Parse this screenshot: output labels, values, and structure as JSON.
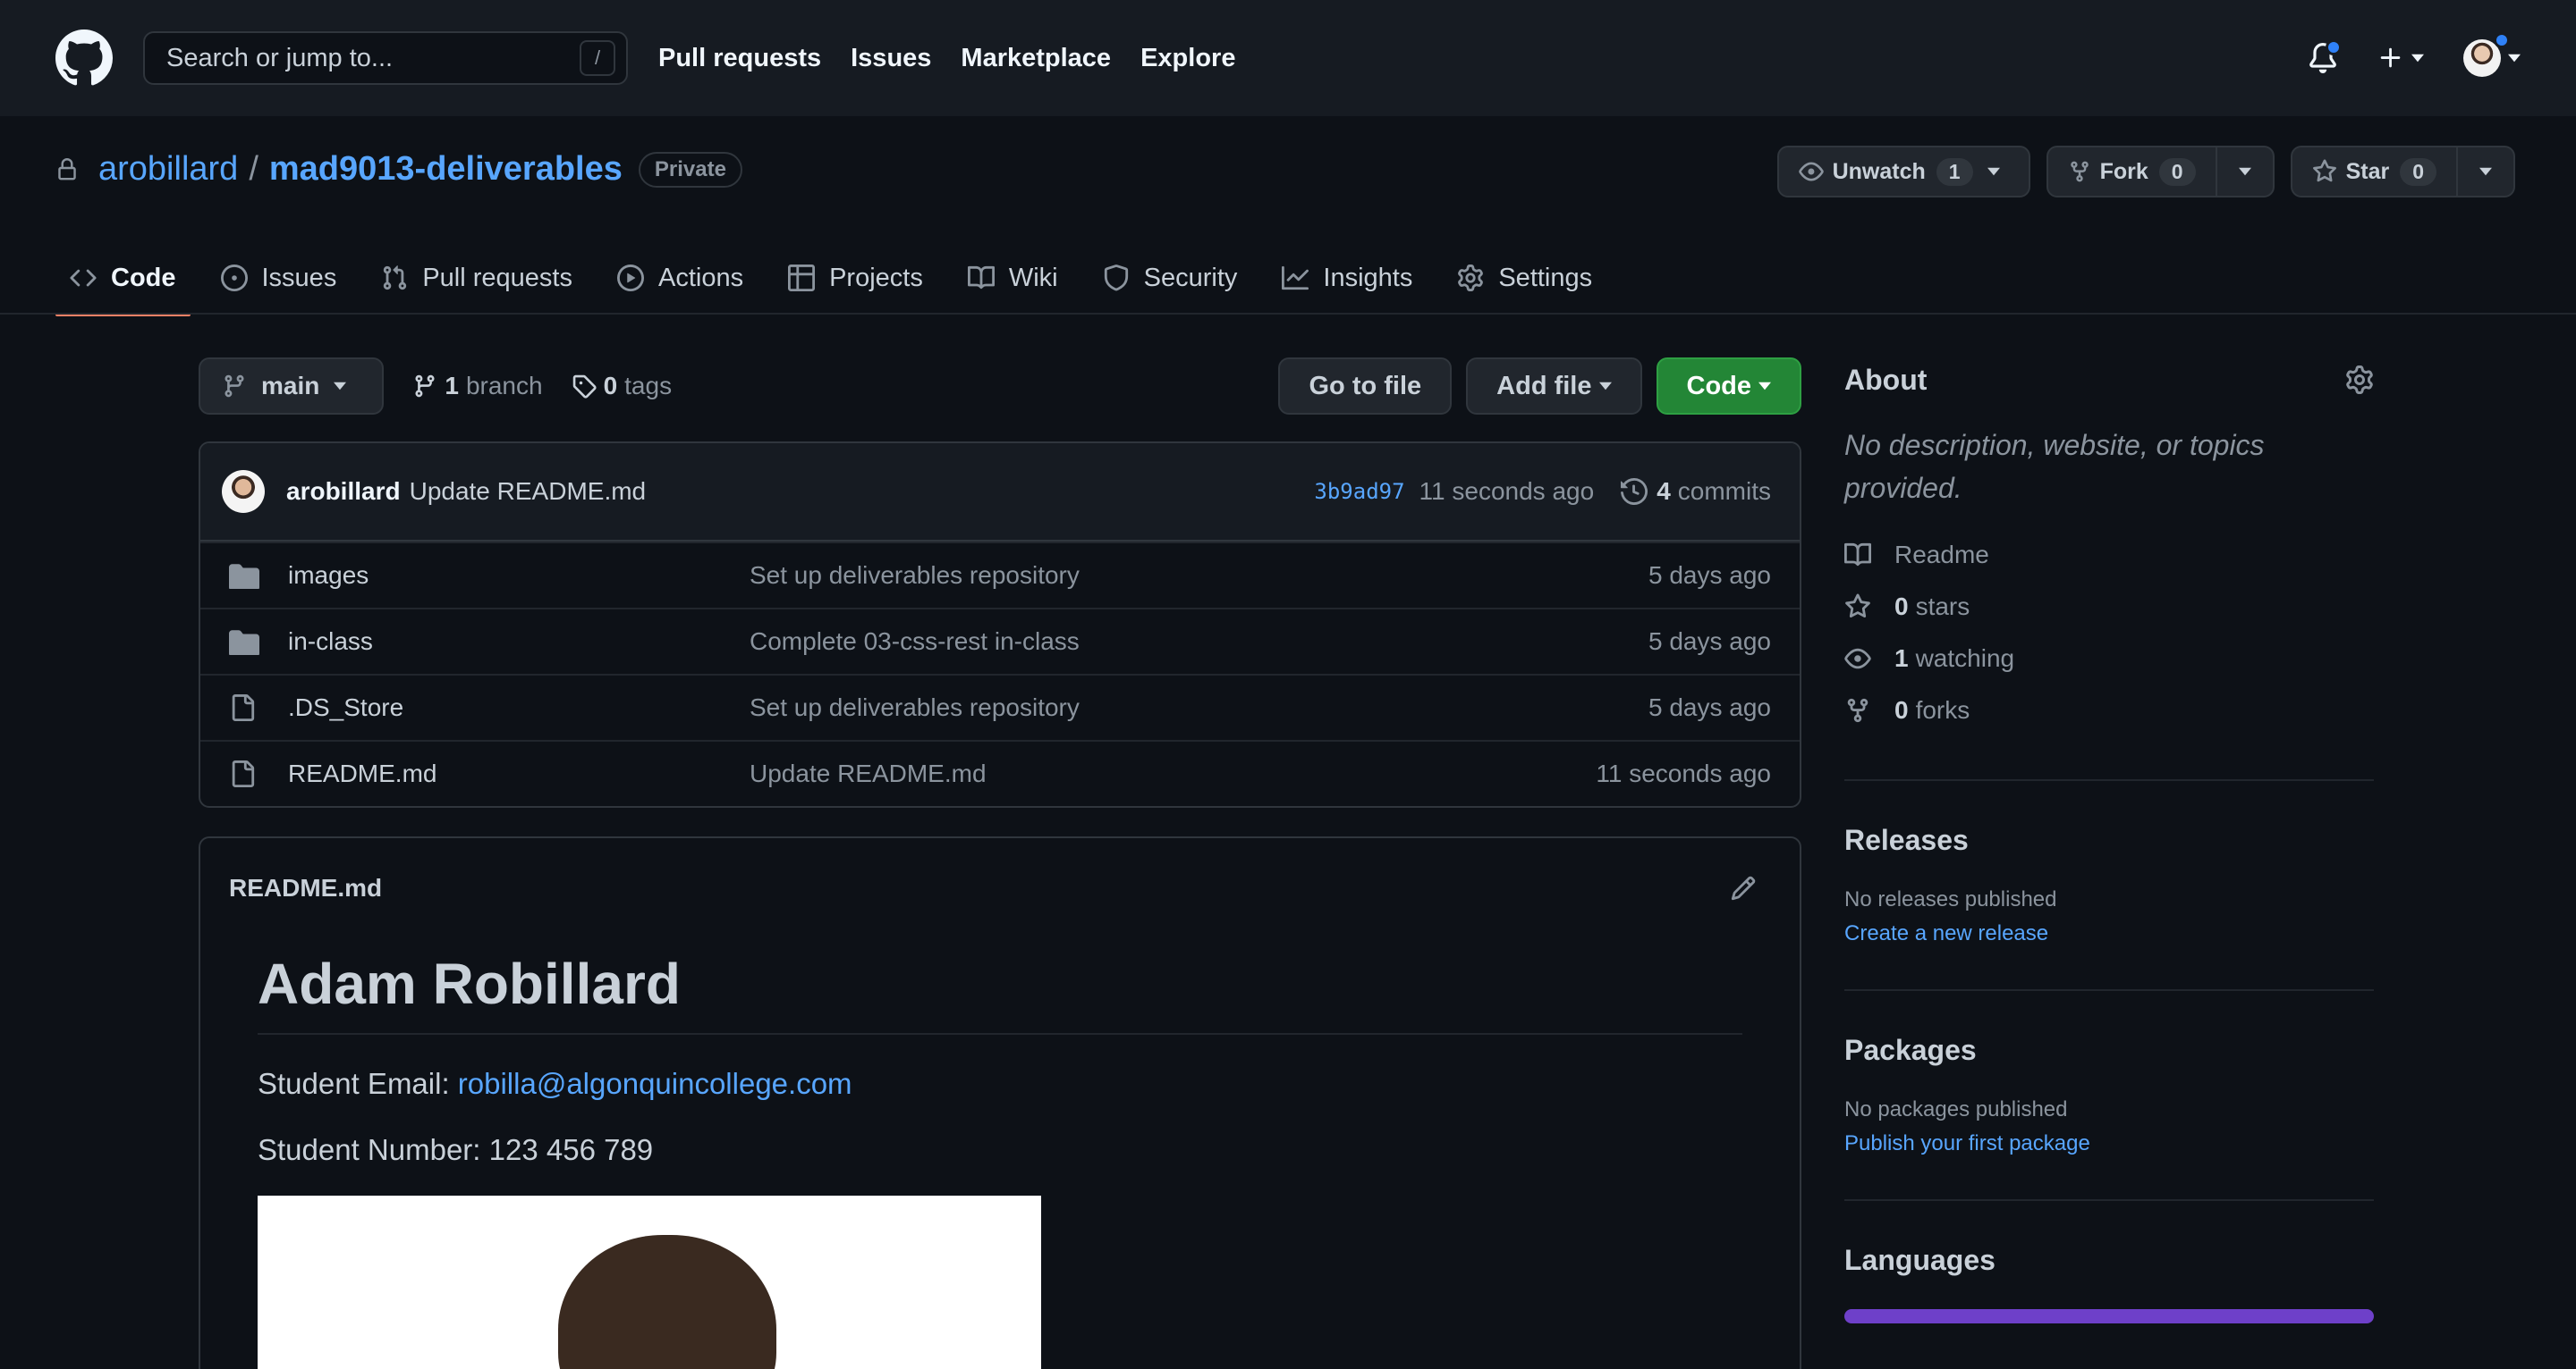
{
  "header": {
    "search_placeholder": "Search or jump to...",
    "search_key": "/",
    "nav": [
      "Pull requests",
      "Issues",
      "Marketplace",
      "Explore"
    ]
  },
  "repo": {
    "owner": "arobillard",
    "separator": "/",
    "name": "mad9013-deliverables",
    "visibility": "Private",
    "watch": {
      "label": "Unwatch",
      "count": "1"
    },
    "fork": {
      "label": "Fork",
      "count": "0"
    },
    "star": {
      "label": "Star",
      "count": "0"
    }
  },
  "tabs": [
    {
      "label": "Code",
      "icon": "code-icon",
      "active": true
    },
    {
      "label": "Issues",
      "icon": "issue-opened-icon"
    },
    {
      "label": "Pull requests",
      "icon": "git-pull-request-icon"
    },
    {
      "label": "Actions",
      "icon": "play-icon"
    },
    {
      "label": "Projects",
      "icon": "table-icon"
    },
    {
      "label": "Wiki",
      "icon": "book-icon"
    },
    {
      "label": "Security",
      "icon": "shield-icon"
    },
    {
      "label": "Insights",
      "icon": "graph-icon"
    },
    {
      "label": "Settings",
      "icon": "gear-icon"
    }
  ],
  "filenav": {
    "branch": "main",
    "branches_count": "1",
    "branches_label": "branch",
    "tags_count": "0",
    "tags_label": "tags",
    "go_to_file": "Go to file",
    "add_file": "Add file",
    "code": "Code"
  },
  "latest_commit": {
    "author": "arobillard",
    "message": "Update README.md",
    "sha": "3b9ad97",
    "age": "11 seconds ago",
    "commits_count": "4",
    "commits_label": "commits"
  },
  "files": [
    {
      "type": "dir",
      "name": "images",
      "message": "Set up deliverables repository",
      "age": "5 days ago"
    },
    {
      "type": "dir",
      "name": "in-class",
      "message": "Complete 03-css-rest in-class",
      "age": "5 days ago"
    },
    {
      "type": "file",
      "name": ".DS_Store",
      "message": "Set up deliverables repository",
      "age": "5 days ago"
    },
    {
      "type": "file",
      "name": "README.md",
      "message": "Update README.md",
      "age": "11 seconds ago"
    }
  ],
  "readme": {
    "title": "README.md",
    "heading": "Adam Robillard",
    "email_label": "Student Email: ",
    "email": "robilla@algonquincollege.com",
    "student_number": "Student Number: 123 456 789"
  },
  "sidebar": {
    "about_title": "About",
    "about_desc": "No description, website, or topics provided.",
    "readme": "Readme",
    "stars_count": "0",
    "stars_label": "stars",
    "watching_count": "1",
    "watching_label": "watching",
    "forks_count": "0",
    "forks_label": "forks",
    "releases_title": "Releases",
    "releases_none": "No releases published",
    "releases_link": "Create a new release",
    "packages_title": "Packages",
    "packages_none": "No packages published",
    "packages_link": "Publish your first package",
    "languages_title": "Languages",
    "language_color": "#6e40c9"
  },
  "colors": {
    "bg": "#0d1117",
    "header": "#161b22",
    "accent": "#58a6ff",
    "green": "#238636",
    "tab_underline": "#f78166"
  }
}
